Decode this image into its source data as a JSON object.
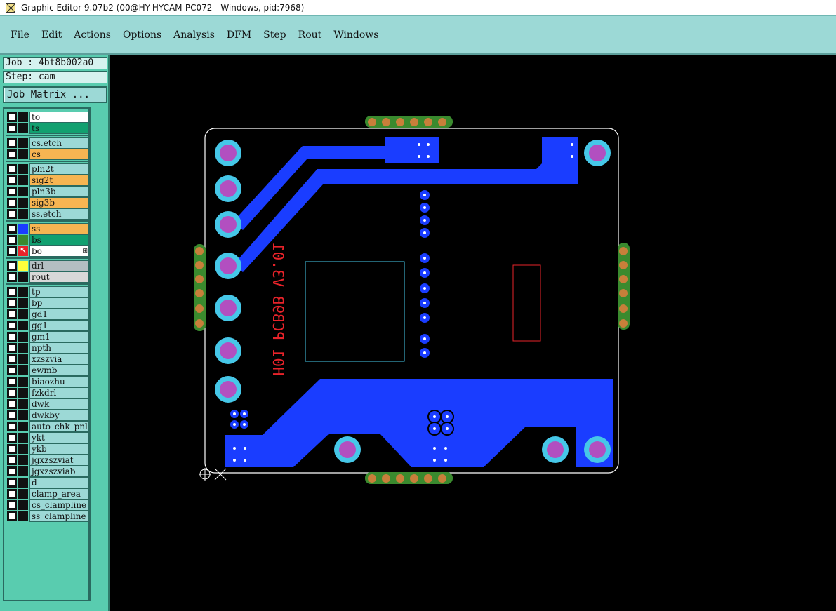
{
  "window": {
    "title": "Graphic Editor 9.07b2 (00@HY-HYCAM-PC072 - Windows, pid:7968)"
  },
  "menu": [
    {
      "first": "F",
      "rest": "ile"
    },
    {
      "first": "E",
      "rest": "dit"
    },
    {
      "first": "A",
      "rest": "ctions"
    },
    {
      "first": "O",
      "rest": "ptions"
    },
    {
      "first": "",
      "rest": "Analysis"
    },
    {
      "first": "",
      "rest": "DFM"
    },
    {
      "first": "S",
      "rest": "tep"
    },
    {
      "first": "R",
      "rest": "out"
    },
    {
      "first": "W",
      "rest": "indows"
    }
  ],
  "job": {
    "job_label": "Job : 4bt8b002a0",
    "step_label": "Step: cam",
    "matrix_button": "Job Matrix ..."
  },
  "layers": [
    {
      "name": "to",
      "bg": "#ffffff",
      "swatch": "#111111"
    },
    {
      "name": "ts",
      "bg": "#12a070",
      "swatch": "#111111"
    },
    {
      "name": "cs.etch",
      "bg": "#9cd9d6",
      "swatch": "#111111"
    },
    {
      "name": "cs",
      "bg": "#f7b552",
      "swatch": "#111111"
    },
    {
      "name": "pln2t",
      "bg": "#9cd9d6",
      "swatch": "#111111"
    },
    {
      "name": "sig2t",
      "bg": "#f7b552",
      "swatch": "#111111"
    },
    {
      "name": "pln3b",
      "bg": "#9cd9d6",
      "swatch": "#111111"
    },
    {
      "name": "sig3b",
      "bg": "#f7b552",
      "swatch": "#111111"
    },
    {
      "name": "ss.etch",
      "bg": "#9cd9d6",
      "swatch": "#111111"
    },
    {
      "name": "ss",
      "bg": "#f7b552",
      "swatch": "#1a3dff"
    },
    {
      "name": "bs",
      "bg": "#12a070",
      "swatch": "#3a8a2e"
    },
    {
      "name": "bo",
      "bg": "#ffffff",
      "swatch": "arrow"
    },
    {
      "name": "drl",
      "bg": "#b4bec2",
      "swatch": "#ffff3a"
    },
    {
      "name": "rout",
      "bg": "#d8d8d8",
      "swatch": "#111111"
    },
    {
      "name": "tp",
      "bg": "#9cd9d6",
      "swatch": "#111111"
    },
    {
      "name": "bp",
      "bg": "#9cd9d6",
      "swatch": "#111111"
    },
    {
      "name": "gd1",
      "bg": "#9cd9d6",
      "swatch": "#111111"
    },
    {
      "name": "gg1",
      "bg": "#9cd9d6",
      "swatch": "#111111"
    },
    {
      "name": "gm1",
      "bg": "#9cd9d6",
      "swatch": "#111111"
    },
    {
      "name": "npth",
      "bg": "#9cd9d6",
      "swatch": "#111111"
    },
    {
      "name": "xzszvia",
      "bg": "#9cd9d6",
      "swatch": "#111111"
    },
    {
      "name": "ewmb",
      "bg": "#9cd9d6",
      "swatch": "#111111"
    },
    {
      "name": "biaozhu",
      "bg": "#9cd9d6",
      "swatch": "#111111"
    },
    {
      "name": "fzkdrl",
      "bg": "#9cd9d6",
      "swatch": "#111111"
    },
    {
      "name": "dwk",
      "bg": "#9cd9d6",
      "swatch": "#111111"
    },
    {
      "name": "dwkby",
      "bg": "#9cd9d6",
      "swatch": "#111111"
    },
    {
      "name": "auto_chk_pnl",
      "bg": "#9cd9d6",
      "swatch": "#111111"
    },
    {
      "name": "ykt",
      "bg": "#9cd9d6",
      "swatch": "#111111"
    },
    {
      "name": "ykb",
      "bg": "#9cd9d6",
      "swatch": "#111111"
    },
    {
      "name": "jgxzszviat",
      "bg": "#9cd9d6",
      "swatch": "#111111"
    },
    {
      "name": "jgxzszviab",
      "bg": "#9cd9d6",
      "swatch": "#111111"
    },
    {
      "name": "d",
      "bg": "#9cd9d6",
      "swatch": "#111111"
    },
    {
      "name": "clamp_area",
      "bg": "#9cd9d6",
      "swatch": "#111111"
    },
    {
      "name": "cs_clampline",
      "bg": "#9cd9d6",
      "swatch": "#111111"
    },
    {
      "name": "ss_clampline",
      "bg": "#9cd9d6",
      "swatch": "#111111"
    }
  ],
  "selected_marker": "⊞",
  "board": {
    "silkscreen_text": "H01_PCB9B_V3.01",
    "colors": {
      "trace": "#1a3dff",
      "pad_outer": "#46c7e8",
      "pad_inner": "#b24fc0",
      "finger": "#3a8a2e",
      "finger_dot": "#c87f3a",
      "silk": "#e8232a",
      "outline": "#ffffff",
      "via_dot": "#ffffff",
      "component_box": "#46c7e8"
    }
  }
}
